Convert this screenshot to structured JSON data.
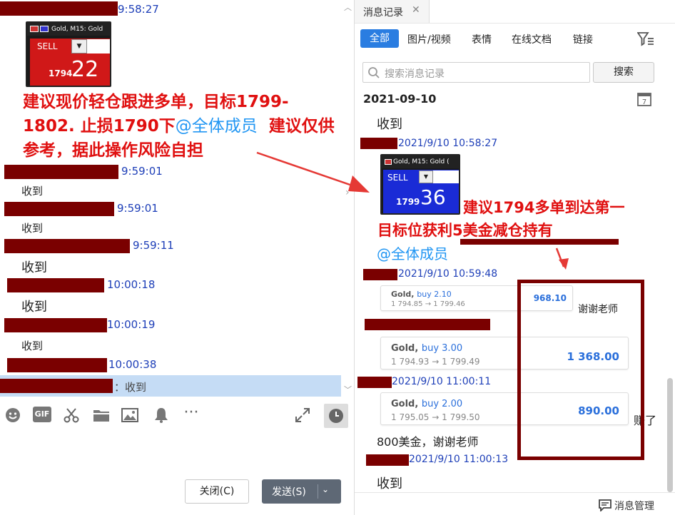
{
  "left": {
    "time1": "9:58:27",
    "card1": {
      "header": "Gold, M15:  Gold",
      "sell_label": "SELL",
      "price_small": "1794",
      "price_big": "22"
    },
    "red_line1": "建议现价轻仓跟进多单，目标1799-",
    "red_line2a": "1802. 止损1790下",
    "red_line2_mention": "@全体成员",
    "red_line2b": "建议仅供",
    "red_line3": "参考，据此操作风险自担",
    "time2": "9:59:01",
    "msg2": "收到",
    "time3": "9:59:01",
    "msg3": "收到",
    "time4": "9:59:11",
    "msg4": "收到",
    "time5": "10:00:18",
    "msg5": "收到",
    "time6": "10:00:19",
    "msg6": "收到",
    "time7": "10:00:38",
    "selected_suffix": "：收到",
    "buttons": {
      "close": "关闭(C)",
      "send": "发送(S)"
    },
    "toolbar": [
      "emoji-icon",
      "gif-icon",
      "scissors-icon",
      "folder-icon",
      "image-icon",
      "bell-icon",
      "more-icon",
      "expand-icon",
      "history-icon"
    ]
  },
  "right": {
    "tab_title": "消息记录",
    "filters": [
      "全部",
      "图片/视频",
      "表情",
      "在线文档",
      "链接"
    ],
    "search_placeholder": "搜索消息记录",
    "search_button": "搜索",
    "date_header": "2021-09-10",
    "msg1": "收到",
    "time1": "2021/9/10 10:58:27",
    "card": {
      "header": "Gold, M15:  Gold (",
      "sell_label": "SELL",
      "price_small": "1799",
      "price_big": "36"
    },
    "red_line1": "建议1794多单到达第一",
    "red_line2": "目标位获利5美金减仓持有",
    "mention": "@全体成员",
    "time2": "2021/9/10 10:59:48",
    "trade1": {
      "symbol": "Gold,",
      "side": "buy 2.10",
      "range": "1 794.85 → 1 799.46",
      "amount": "968.10"
    },
    "thanks1": "谢谢老师",
    "trade2": {
      "symbol": "Gold,",
      "side": "buy 3.00",
      "range": "1 794.93 → 1 799.49",
      "amount": "1 368.00"
    },
    "time3": "2021/9/10 11:00:11",
    "trade3": {
      "symbol": "Gold,",
      "side": "buy 2.00",
      "range": "1 795.05 → 1 799.50",
      "amount": "890.00"
    },
    "earned": "赚了",
    "msg2": "800美金，谢谢老师",
    "time4": "2021/9/10 11:00:13",
    "msg3": "收到",
    "manage": "消息管理"
  },
  "colors": {
    "accent": "#2a7de1",
    "red_text": "#e01010",
    "redact": "#7a0000",
    "time_blue": "#1e3fb8",
    "selected_row": "#c5dcf5"
  }
}
